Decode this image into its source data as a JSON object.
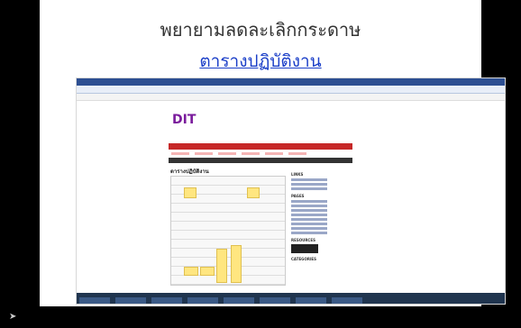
{
  "slide": {
    "title": "พยายามลดละเลิกกระดาษ",
    "link": "ตารางปฏิบัติงาน"
  },
  "screenshot": {
    "page_heading": "ตารางปฏิบัติงาน",
    "sidebar_headings": [
      "LINKS",
      "PAGES",
      "RESOURCES",
      "CATEGORIES"
    ]
  }
}
